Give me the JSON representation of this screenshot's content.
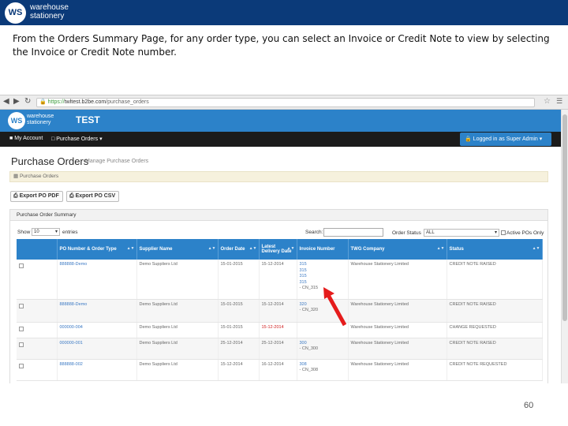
{
  "slide": {
    "logo_initials": "WS",
    "logo_line1": "warehouse",
    "logo_line2": "stationery",
    "caption": "From the Orders Summary Page, for any order type, you can select an Invoice or Credit Note to view by selecting the Invoice or Credit Note number.",
    "page_number": "60"
  },
  "browser": {
    "url_scheme": "https://",
    "url_host": "twltest.b2be.com",
    "url_path": "/purchase_orders"
  },
  "app": {
    "logo_initials": "WS",
    "logo_line1": "warehouse",
    "logo_line2": "stationery",
    "env_label": "TEST",
    "nav": {
      "my_account": "My Account",
      "purchase_orders": "Purchase Orders",
      "logged_in": "Logged in as Super Admin"
    },
    "page_title": "Purchase Orders",
    "page_subtitle": "Manage Purchase Orders",
    "breadcrumb": "Purchase Orders",
    "export_pdf": "Export PO PDF",
    "export_csv": "Export PO CSV",
    "summary_title": "Purchase Order Summary",
    "show_label": "Show",
    "show_value": "10",
    "entries_label": "entries",
    "search_label": "Search:",
    "order_status_label": "Order Status",
    "order_status_value": "ALL",
    "active_only_label": "Active POs Only",
    "colors": {
      "header_blue": "#2c82c9",
      "nav_dark": "#1b1b1b",
      "slide_blue": "#0b3a79",
      "arrow_red": "#e51c1c"
    },
    "table": {
      "headers": [
        "PO Number & Order Type",
        "Supplier Name",
        "Order Date",
        "Latest Delivery Date",
        "Invoice Number",
        "TWG Company",
        "Status"
      ],
      "rows": [
        {
          "po": "888888-Demo",
          "supplier": "Demo Suppliers Ltd",
          "order_date": "15-01-2015",
          "delivery": "15-12-2014",
          "invoices": [
            "315",
            "315",
            "315",
            "315"
          ],
          "credit_note": "- CN_315",
          "company": "Warehouse Stationery Limited",
          "status": "CREDIT NOTE RAISED"
        },
        {
          "po": "888888-Demo",
          "supplier": "Demo Suppliers Ltd",
          "order_date": "15-01-2015",
          "delivery": "15-12-2014",
          "invoices": [
            "320"
          ],
          "credit_note": "- CN_320",
          "company": "Warehouse Stationery Limited",
          "status": "CREDIT NOTE RAISED"
        },
        {
          "po": "000000-004",
          "supplier": "Demo Suppliers Ltd",
          "order_date": "15-01-2015",
          "delivery": "15-12-2014",
          "invoices": [],
          "credit_note": "",
          "company": "Warehouse Stationery Limited",
          "status": "CHANGE REQUESTED"
        },
        {
          "po": "000000-001",
          "supplier": "Demo Suppliers Ltd",
          "order_date": "25-12-2014",
          "delivery": "25-12-2014",
          "invoices": [
            "300"
          ],
          "credit_note": "- CN_300",
          "company": "Warehouse Stationery Limited",
          "status": "CREDIT NOTE RAISED"
        },
        {
          "po": "888888-002",
          "supplier": "Demo Suppliers Ltd",
          "order_date": "15-12-2014",
          "delivery": "16-12-2014",
          "invoices": [
            "308"
          ],
          "credit_note": "- CN_308",
          "company": "Warehouse Stationery Limited",
          "status": "CREDIT NOTE REQUESTED"
        }
      ]
    }
  }
}
